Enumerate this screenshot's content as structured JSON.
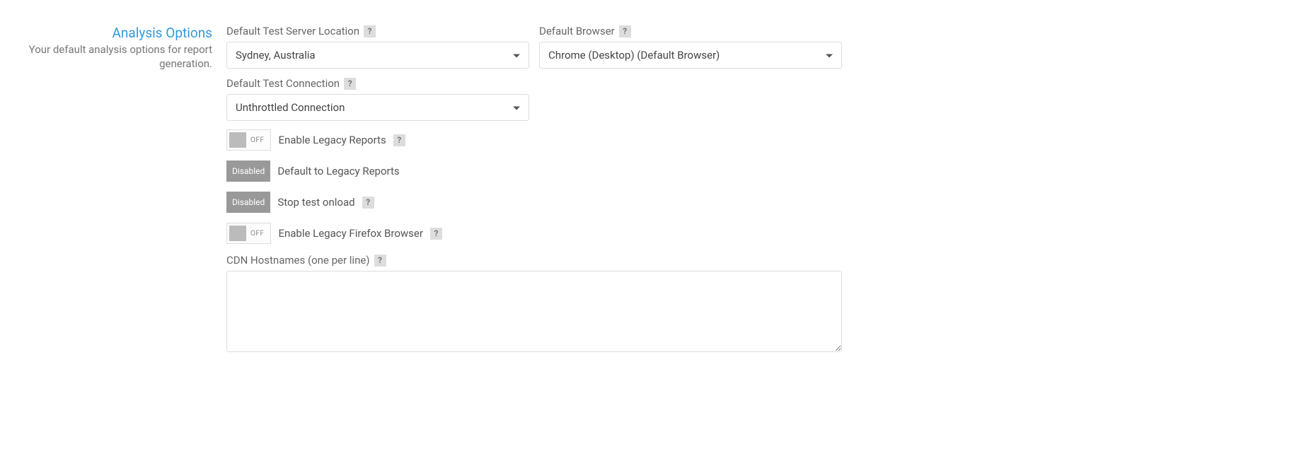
{
  "section": {
    "title": "Analysis Options",
    "description": "Your default analysis options for report generation."
  },
  "fields": {
    "server_location": {
      "label": "Default Test Server Location",
      "value": "Sydney, Australia"
    },
    "browser": {
      "label": "Default Browser",
      "value": "Chrome (Desktop) (Default Browser)"
    },
    "connection": {
      "label": "Default Test Connection",
      "value": "Unthrottled Connection"
    },
    "cdn_hostnames": {
      "label": "CDN Hostnames (one per line)",
      "value": ""
    }
  },
  "toggles": {
    "legacy_reports": {
      "state": "OFF",
      "label": "Enable Legacy Reports"
    },
    "default_legacy": {
      "state": "Disabled",
      "label": "Default to Legacy Reports"
    },
    "stop_onload": {
      "state": "Disabled",
      "label": "Stop test onload"
    },
    "legacy_firefox": {
      "state": "OFF",
      "label": "Enable Legacy Firefox Browser"
    }
  },
  "help_glyph": "?"
}
